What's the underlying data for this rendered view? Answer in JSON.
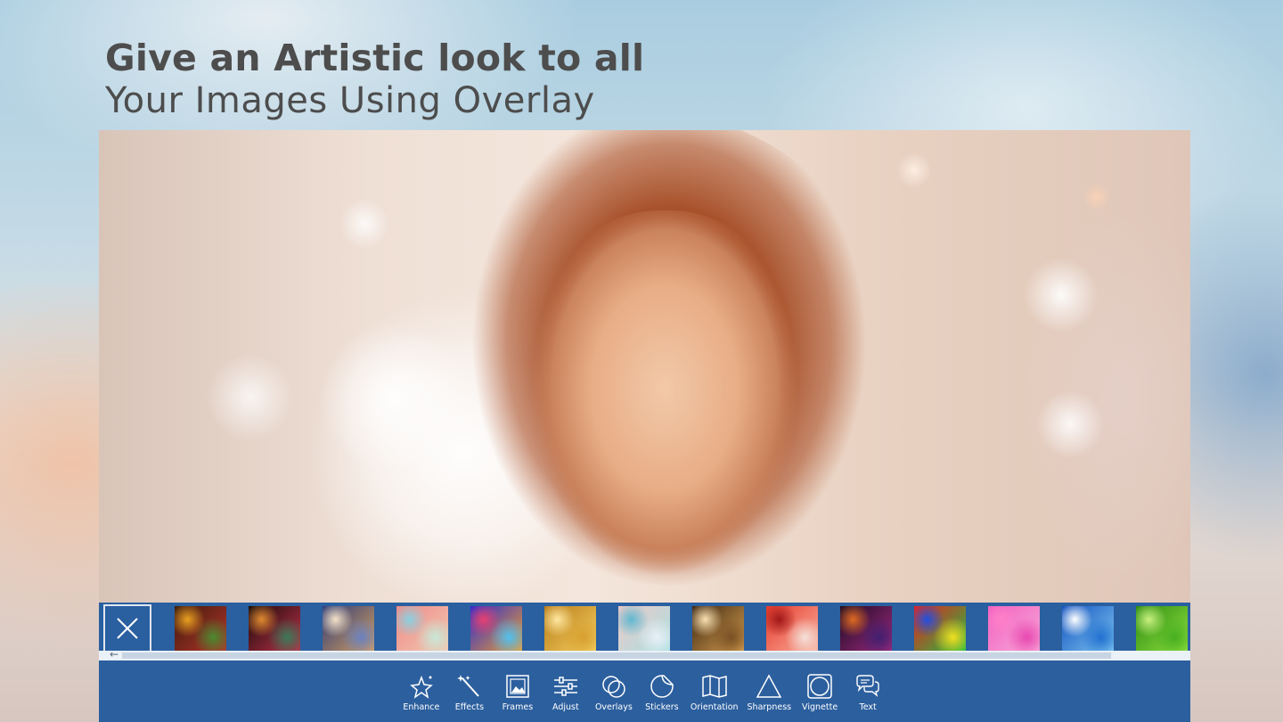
{
  "headline": {
    "line1": "Give an Artistic look to all",
    "line2": "Your Images Using Overlay"
  },
  "overlay_thumbnails": [
    {
      "name": "bokeh-red-green",
      "colors": [
        "#3a1a0c",
        "#b8342a",
        "#e8a020",
        "#4a8a30"
      ]
    },
    {
      "name": "bokeh-dark-multicolor",
      "colors": [
        "#160b08",
        "#c0304a",
        "#e08a30",
        "#3c7a5a"
      ]
    },
    {
      "name": "bokeh-blue-gold",
      "colors": [
        "#2a3a78",
        "#d8a060",
        "#f4e2c8",
        "#6a82c0"
      ]
    },
    {
      "name": "pastel-gradient",
      "colors": [
        "#f08a88",
        "#f0c8b0",
        "#8ad0e0",
        "#c8e8d8"
      ]
    },
    {
      "name": "light-streaks-blue",
      "colors": [
        "#2a2ad0",
        "#f0a030",
        "#e84070",
        "#50c0f0"
      ]
    },
    {
      "name": "gold-glitter",
      "colors": [
        "#b87a18",
        "#f4d060",
        "#ffe8a0",
        "#d8a030"
      ]
    },
    {
      "name": "teal-waves",
      "colors": [
        "#f0c8c8",
        "#a8e0e0",
        "#60b8d0",
        "#e8f0f8"
      ]
    },
    {
      "name": "gold-bokeh-dark",
      "colors": [
        "#3a2410",
        "#d8a050",
        "#f8e0b0",
        "#7a5024"
      ]
    },
    {
      "name": "red-swirl",
      "colors": [
        "#e83a2a",
        "#f8b0a0",
        "#a01818",
        "#f4e0d8"
      ]
    },
    {
      "name": "purple-fire",
      "colors": [
        "#1a0a20",
        "#a02a80",
        "#e06a20",
        "#402070"
      ]
    },
    {
      "name": "rainbow-burst",
      "colors": [
        "#e82020",
        "#20c040",
        "#2050e0",
        "#f0e020"
      ]
    },
    {
      "name": "pink-magenta",
      "colors": [
        "#f060c0",
        "#f8a8d8",
        "#ff80c8",
        "#e848b0"
      ]
    },
    {
      "name": "blue-swirl",
      "colors": [
        "#1050c0",
        "#80c8f0",
        "#ffffff",
        "#2070d0"
      ]
    },
    {
      "name": "green-rays",
      "colors": [
        "#2a8a10",
        "#90e040",
        "#c8f080",
        "#48b020"
      ]
    }
  ],
  "tools": [
    {
      "label": "Enhance",
      "icon": "sparkle-star-icon"
    },
    {
      "label": "Effects",
      "icon": "magic-wand-icon"
    },
    {
      "label": "Frames",
      "icon": "picture-frame-icon"
    },
    {
      "label": "Adjust",
      "icon": "sliders-icon"
    },
    {
      "label": "Overlays",
      "icon": "overlapping-circles-icon"
    },
    {
      "label": "Stickers",
      "icon": "sticker-icon"
    },
    {
      "label": "Orientation",
      "icon": "folded-map-icon"
    },
    {
      "label": "Sharpness",
      "icon": "triangle-icon"
    },
    {
      "label": "Vignette",
      "icon": "vignette-square-icon"
    },
    {
      "label": "Text",
      "icon": "speech-bubbles-icon"
    }
  ],
  "colors": {
    "toolbar_bg": "#2c5f9e",
    "headline_text": "#4d4d4d",
    "tool_label": "#ffffff"
  }
}
